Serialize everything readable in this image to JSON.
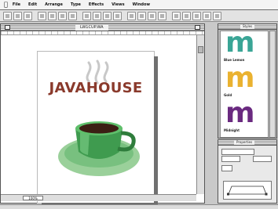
{
  "menubar": {
    "items": [
      {
        "label": "File"
      },
      {
        "label": "Edit"
      },
      {
        "label": "Arrange"
      },
      {
        "label": "Type"
      },
      {
        "label": "Effects"
      },
      {
        "label": "Views"
      },
      {
        "label": "Window"
      }
    ]
  },
  "document": {
    "title": "LW1CUP.WA",
    "zoom": "100%",
    "poster": {
      "title": "JAVAHOUSE"
    }
  },
  "styles_palette": {
    "title": "Styles",
    "items": [
      {
        "label": "Blue Lemon",
        "color": "#3aa596"
      },
      {
        "label": "Gold",
        "color": "#eab230"
      },
      {
        "label": "Midnight",
        "color": "#6a2a80"
      }
    ]
  },
  "properties_palette": {
    "title": "Properties"
  },
  "colors": {
    "accent_title": "#8a3a2c",
    "cup_green": "#3f9b4f",
    "saucer_green": "#9ad09a"
  }
}
